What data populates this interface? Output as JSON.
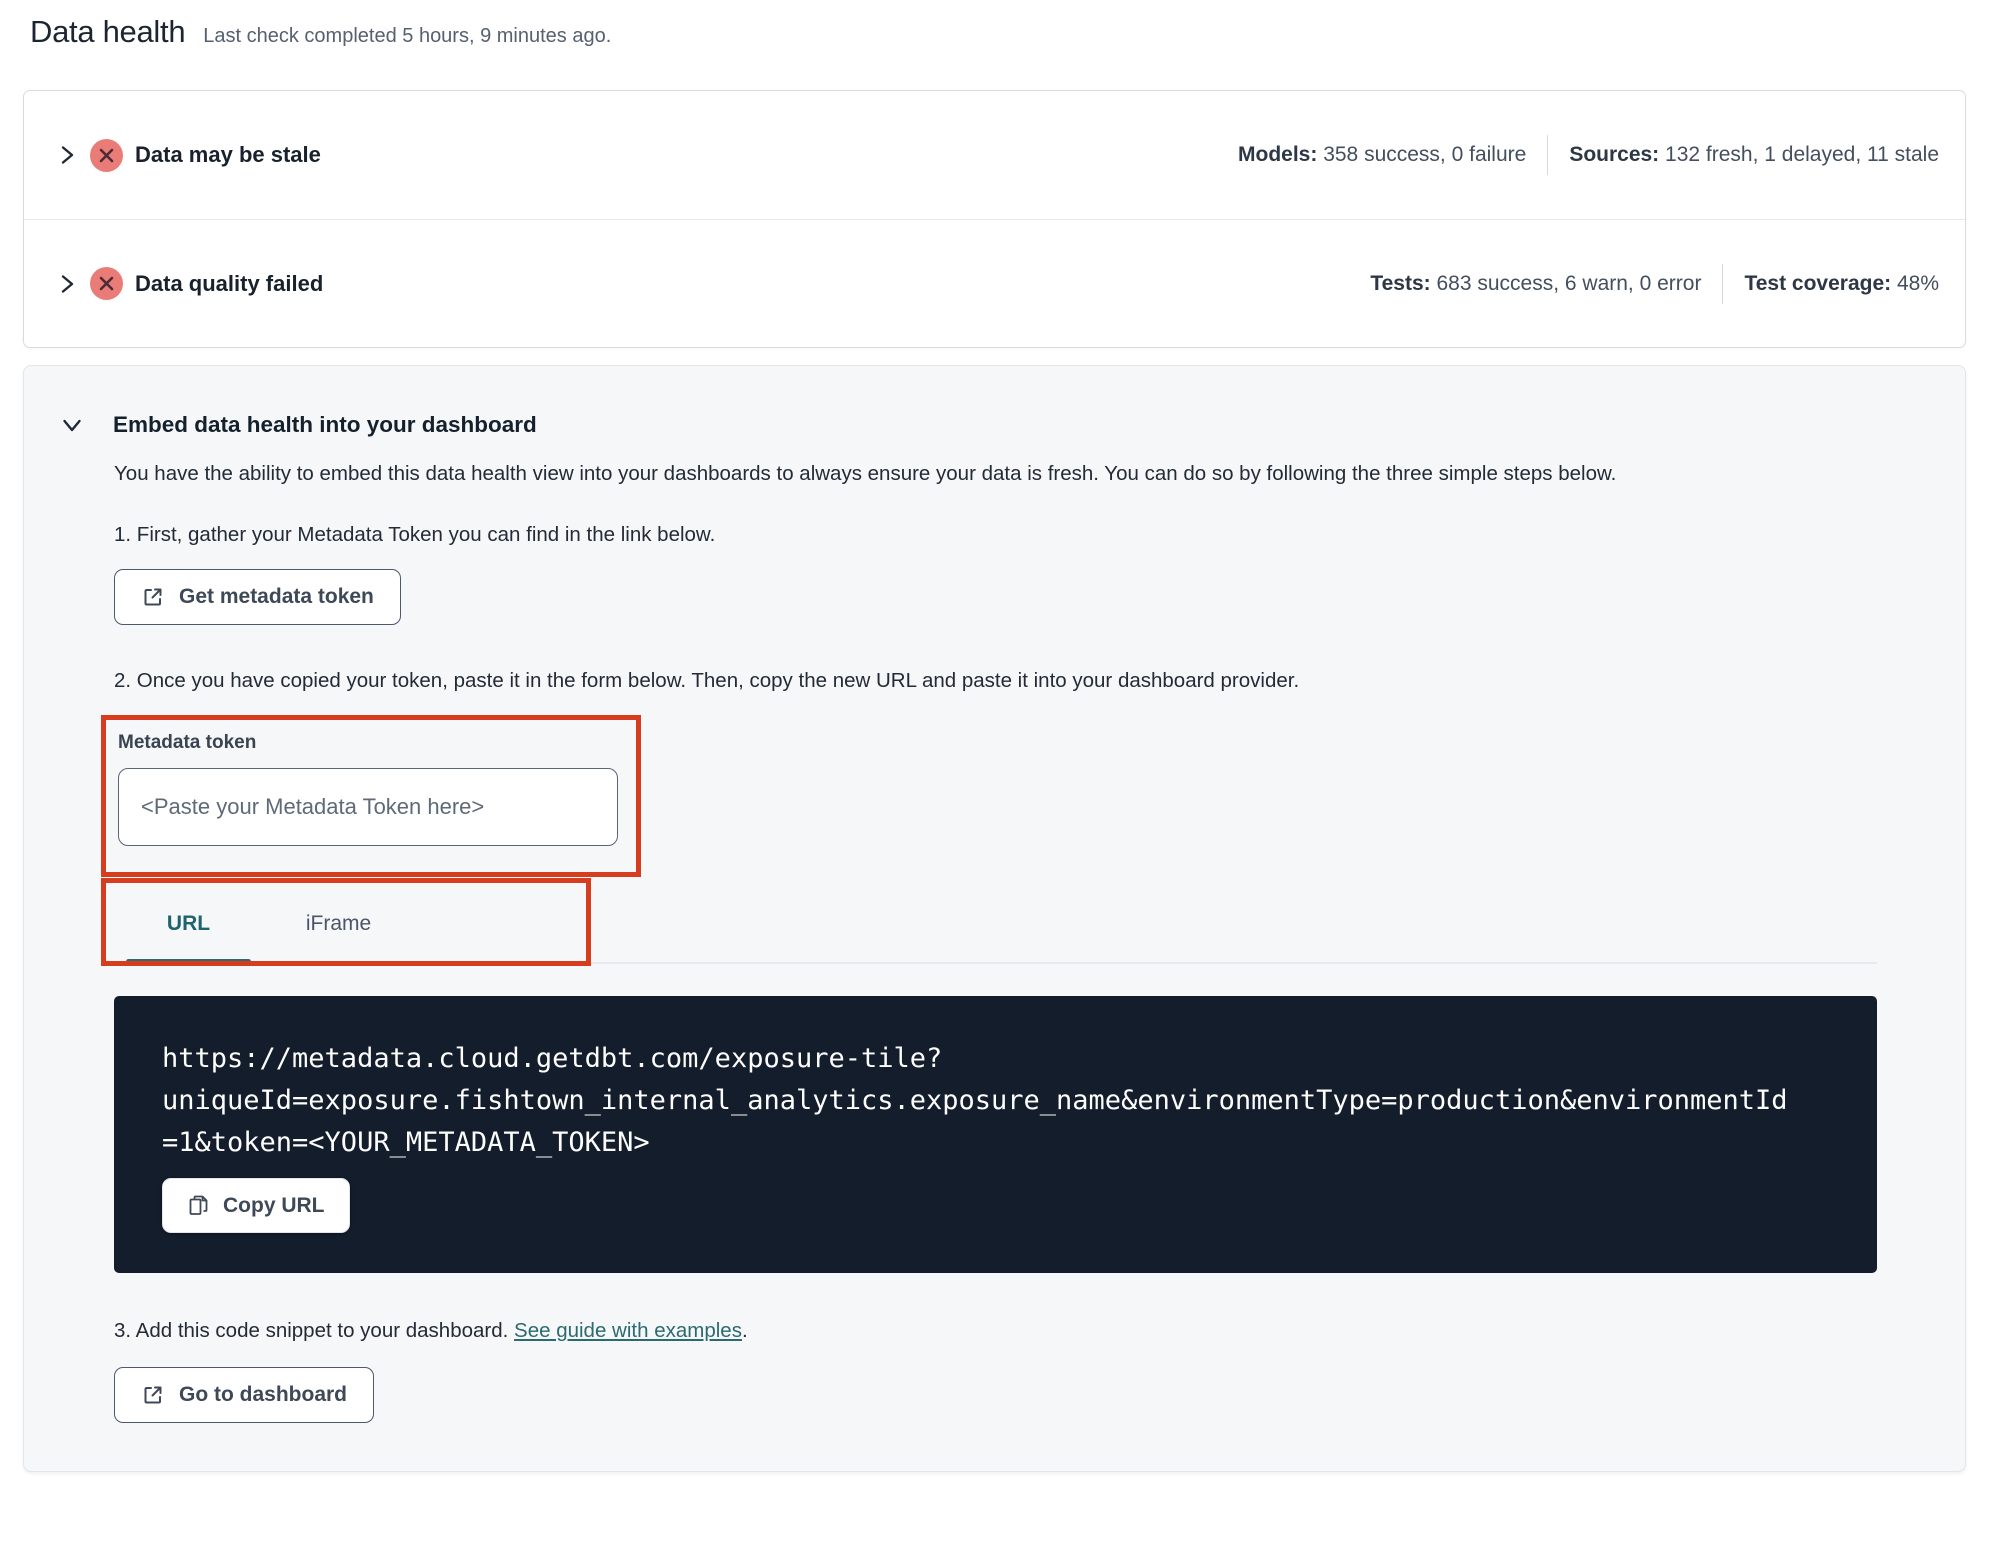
{
  "page": {
    "title": "Data health",
    "subtitle": "Last check completed 5 hours, 9 minutes ago."
  },
  "status_rows": [
    {
      "label": "Data may be stale",
      "stats": [
        {
          "label": "Models:",
          "value": "358 success, 0 failure"
        },
        {
          "label": "Sources:",
          "value": "132 fresh, 1 delayed, 11 stale"
        }
      ]
    },
    {
      "label": "Data quality failed",
      "stats": [
        {
          "label": "Tests:",
          "value": "683 success, 6 warn, 0 error"
        },
        {
          "label": "Test coverage:",
          "value": "48%"
        }
      ]
    }
  ],
  "embed": {
    "title": "Embed data health into your dashboard",
    "description": "You have the ability to embed this data health view into your dashboards to always ensure your data is fresh. You can do so by following the three simple steps below.",
    "step1": "1. First, gather your Metadata Token you can find in the link below.",
    "get_token_button": "Get metadata token",
    "step2": "2. Once you have copied your token, paste it in the form below. Then, copy the new URL and paste it into your dashboard provider.",
    "token_field": {
      "label": "Metadata token",
      "placeholder": "<Paste your Metadata Token here>"
    },
    "tabs": [
      {
        "label": "URL"
      },
      {
        "label": "iFrame"
      }
    ],
    "code_url": "https://metadata.cloud.getdbt.com/exposure-tile?uniqueId=exposure.fishtown_internal_analytics.exposure_name&environmentType=production&environmentId=1&token=<YOUR_METADATA_TOKEN>",
    "code_url_lines": [
      "https://metadata.cloud.getdbt.com/exposure-tile?",
      "uniqueId=exposure.fishtown_internal_analytics.exposure_name&environmentType=production&environmentId",
      "=1&token=<YOUR_METADATA_TOKEN>"
    ],
    "copy_button": "Copy URL",
    "step3_prefix": "3. Add this code snippet to your dashboard. ",
    "step3_link": "See guide with examples",
    "step3_suffix": ".",
    "dashboard_button": "Go to dashboard"
  },
  "colors": {
    "accent_teal": "#1f646c",
    "annotation_red": "#d63d1e",
    "status_icon_bg": "#ea7c77",
    "status_icon_x": "#4c2b34",
    "code_block_bg": "#141d2c",
    "card_bg": "#f6f7f9"
  }
}
